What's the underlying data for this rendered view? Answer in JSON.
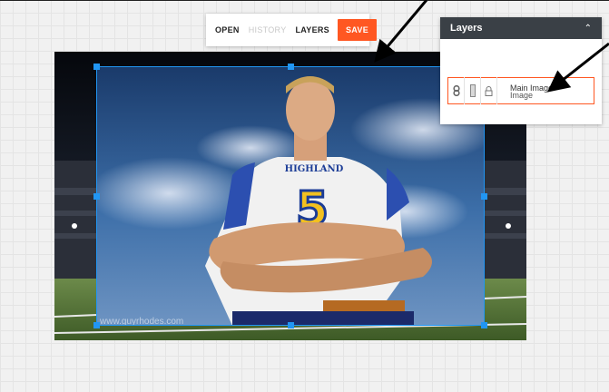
{
  "toolbar": {
    "open_label": "OPEN",
    "history_label": "HISTORY",
    "layers_label": "LAYERS",
    "save_label": "SAVE"
  },
  "canvas": {
    "watermark": "www.guyrhodes.com",
    "jersey_text": "HIGHLAND",
    "jersey_number": "5"
  },
  "layers_panel": {
    "title": "Layers",
    "items": [
      {
        "name": "Main Image",
        "type": "Image"
      }
    ]
  },
  "colors": {
    "accent": "#ff5722",
    "selection": "#2196f3",
    "panel_header": "#3a4046"
  }
}
